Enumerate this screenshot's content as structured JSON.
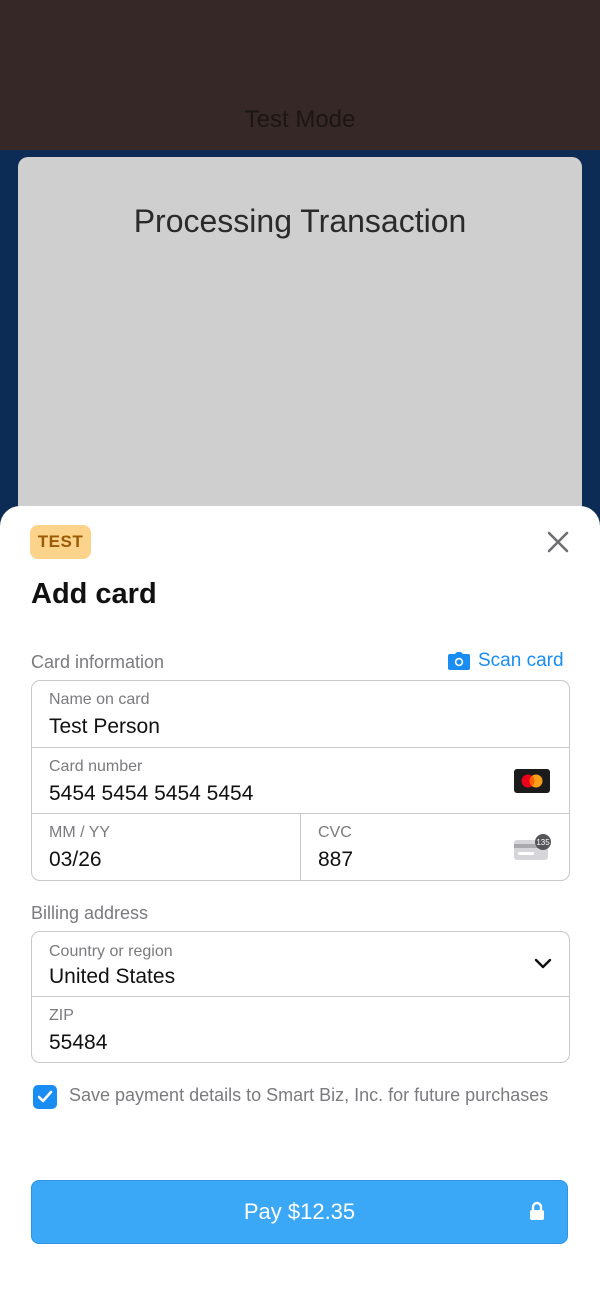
{
  "background": {
    "title": "Test Mode",
    "processing_title": "Processing Transaction"
  },
  "sheet": {
    "badge": "TEST",
    "title": "Add card",
    "card_section_label": "Card information",
    "scan_card_label": "Scan card",
    "name_field": {
      "label": "Name on card",
      "value": "Test Person"
    },
    "card_number_field": {
      "label": "Card number",
      "value": "5454 5454 5454 5454",
      "brand_icon": "mastercard-icon"
    },
    "expiry_field": {
      "label": "MM / YY",
      "value": "03/26"
    },
    "cvc_field": {
      "label": "CVC",
      "value": "887",
      "hint_number": "135"
    },
    "billing_section_label": "Billing address",
    "country_field": {
      "label": "Country or region",
      "value": "United States"
    },
    "zip_field": {
      "label": "ZIP",
      "value": "55484"
    },
    "save_checkbox": {
      "checked": true,
      "label": "Save payment details to Smart Biz, Inc. for future purchases"
    },
    "pay_button_label": "Pay $12.35"
  },
  "colors": {
    "accent": "#1a8df2",
    "pay_button": "#3ba7f7",
    "badge_bg": "#fcd38b",
    "badge_text": "#9a5a08",
    "top_band": "#352826",
    "backdrop": "#0c2b55"
  }
}
